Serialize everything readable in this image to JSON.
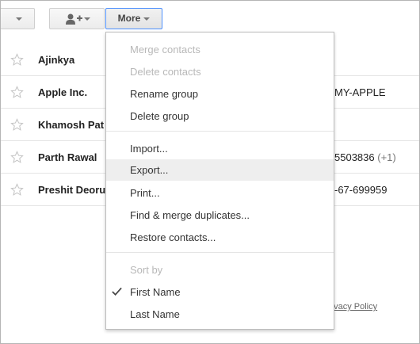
{
  "toolbar": {
    "more_label": "More"
  },
  "contacts": [
    {
      "name": "Ajinkya",
      "extra": "",
      "extra_muted": ""
    },
    {
      "name": "Apple Inc.",
      "extra": "MY-APPLE",
      "extra_muted": ""
    },
    {
      "name": "Khamosh Pat",
      "extra": "",
      "extra_muted": ""
    },
    {
      "name": "Parth Rawal",
      "extra": "5503836",
      "extra_muted": " (+1)"
    },
    {
      "name": "Preshit Deoru",
      "extra": "-67-699959",
      "extra_muted": ""
    }
  ],
  "footer": {
    "privacy": "rivacy Policy"
  },
  "menu": {
    "merge_contacts": "Merge contacts",
    "delete_contacts": "Delete contacts",
    "rename_group": "Rename group",
    "delete_group": "Delete group",
    "import": "Import...",
    "export": "Export...",
    "print": "Print...",
    "find_merge": "Find & merge duplicates...",
    "restore": "Restore contacts...",
    "sort_by": "Sort by",
    "first_name": "First Name",
    "last_name": "Last Name"
  },
  "colors": {
    "accent": "#4d90fe",
    "highlight": "#eeeeee",
    "disabled": "#b8b8b8"
  }
}
